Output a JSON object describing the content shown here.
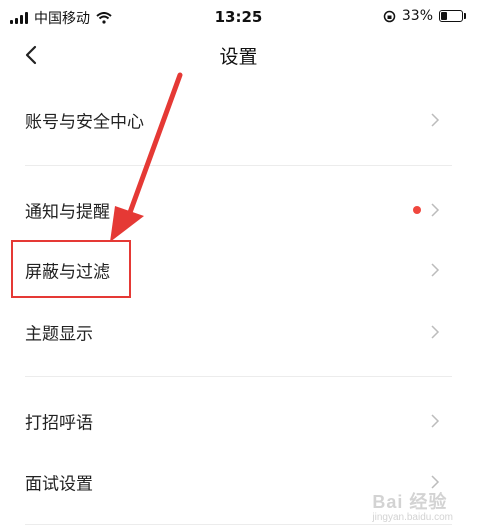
{
  "status_bar": {
    "carrier": "中国移动",
    "time": "13:25",
    "battery": "33%",
    "battery_level": 0.33
  },
  "nav": {
    "title": "设置"
  },
  "menu": [
    {
      "label": "账号与安全中心",
      "badge": false
    },
    {
      "label": "通知与提醒",
      "badge": true
    },
    {
      "label": "屏蔽与过滤",
      "badge": false,
      "highlighted": true
    },
    {
      "label": "主题显示",
      "badge": false
    },
    {
      "label": "打招呼语",
      "badge": false
    },
    {
      "label": "面试设置",
      "badge": false
    }
  ],
  "watermark": {
    "main": "Bai 经验",
    "sub": "jingyan.baidu.com"
  },
  "colors": {
    "annotation": "#e53935",
    "badge": "#f0473e"
  }
}
